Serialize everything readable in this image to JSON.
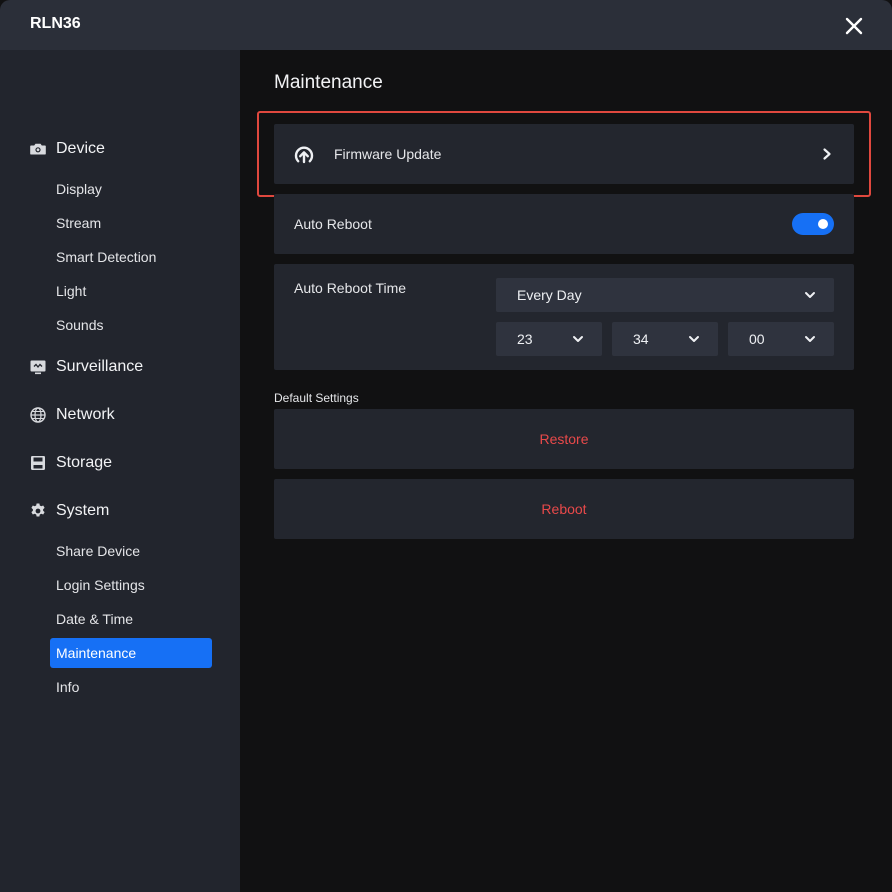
{
  "window": {
    "title": "RLN36"
  },
  "sidebar": {
    "groups": [
      {
        "label": "Device",
        "icon": "camera-icon",
        "items": [
          "Display",
          "Stream",
          "Smart Detection",
          "Light",
          "Sounds"
        ]
      },
      {
        "label": "Surveillance",
        "icon": "monitor-icon",
        "items": []
      },
      {
        "label": "Network",
        "icon": "globe-icon",
        "items": []
      },
      {
        "label": "Storage",
        "icon": "floppy-disk-icon",
        "items": []
      },
      {
        "label": "System",
        "icon": "gear-icon",
        "items": [
          "Share Device",
          "Login Settings",
          "Date & Time",
          "Maintenance",
          "Info"
        ]
      }
    ],
    "active_item": "Maintenance"
  },
  "main": {
    "title": "Maintenance",
    "firmware": {
      "label": "Firmware Update",
      "icon": "upload-icon"
    },
    "auto_reboot": {
      "label": "Auto Reboot",
      "enabled": true
    },
    "auto_reboot_time": {
      "label": "Auto Reboot Time",
      "frequency": "Every Day",
      "hour": "23",
      "minute": "34",
      "second": "00"
    },
    "default_settings": {
      "label": "Default Settings",
      "restore_label": "Restore",
      "reboot_label": "Reboot"
    }
  },
  "colors": {
    "accent": "#1670f5",
    "danger": "#e8494a",
    "highlight": "#e0483e"
  }
}
